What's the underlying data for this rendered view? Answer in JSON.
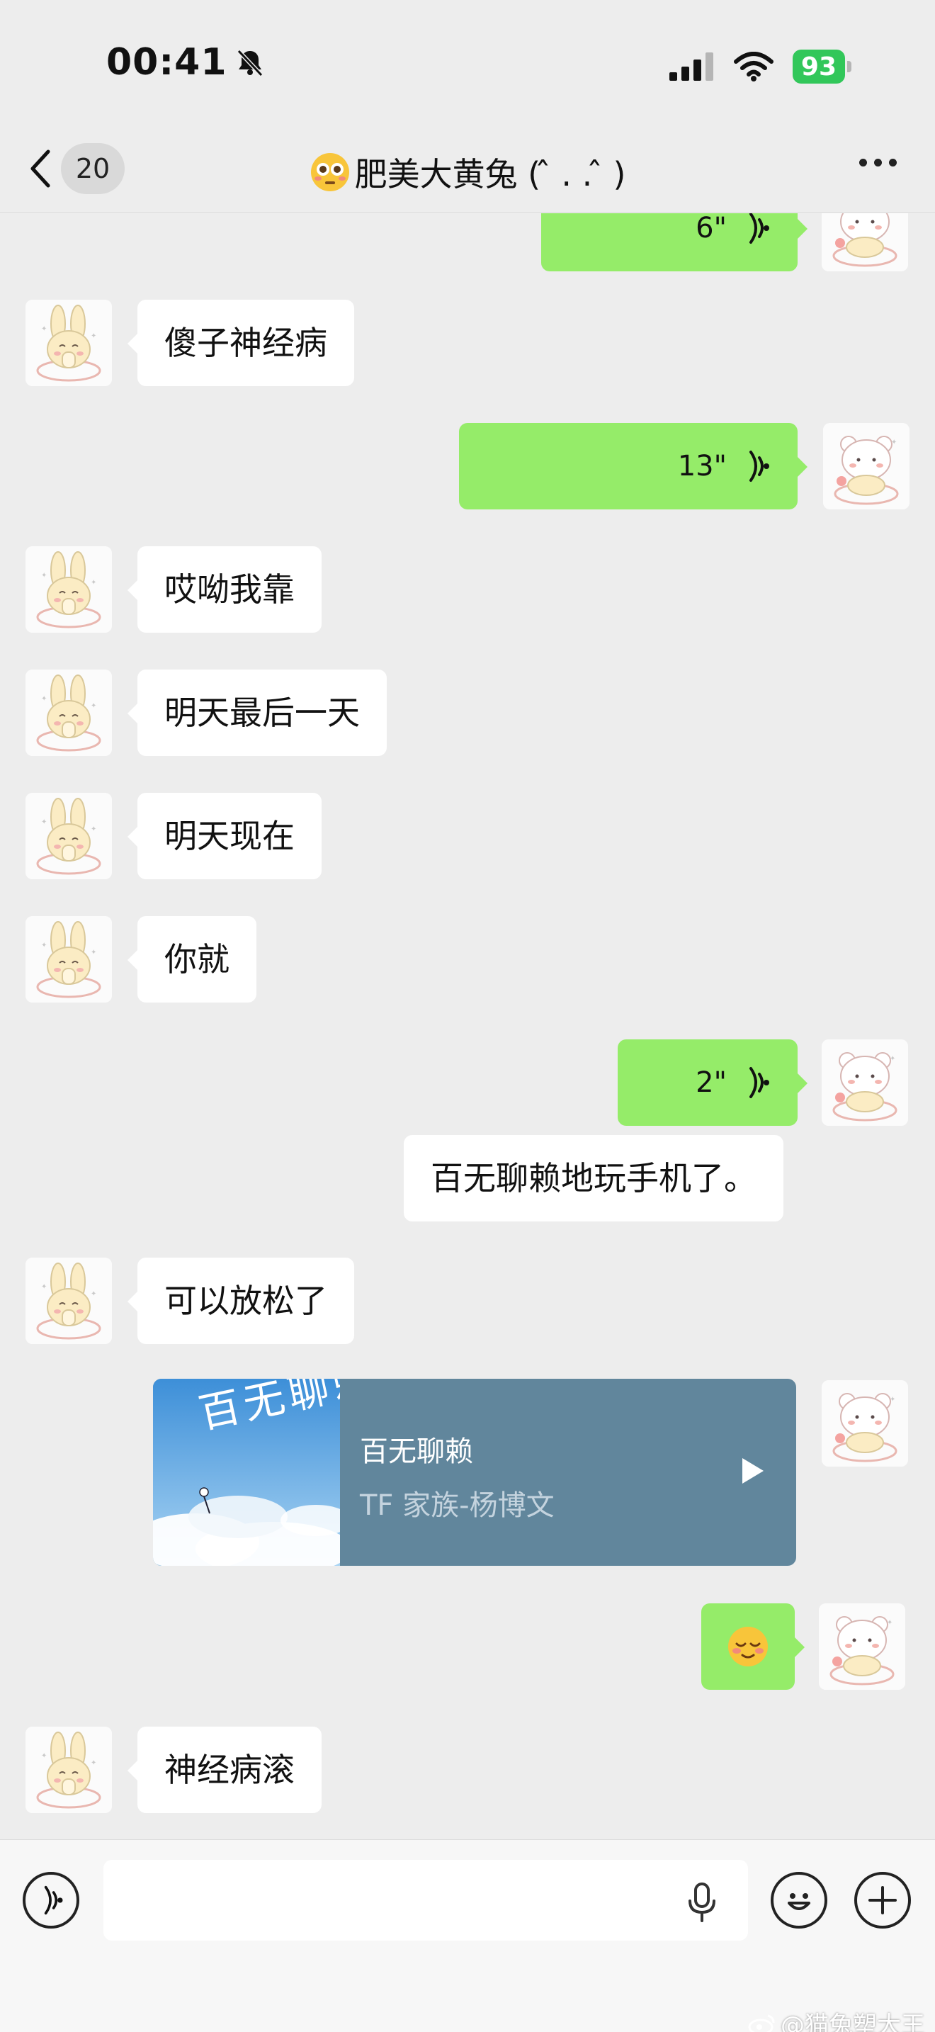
{
  "status_bar": {
    "time": "00:41",
    "battery": "93",
    "icons": [
      "bell-slash-icon",
      "cellular-signal-icon",
      "wifi-icon",
      "battery-icon"
    ]
  },
  "nav": {
    "back_count": "20",
    "title": "肥美大黄兔 ( ̂ . . ̂ )",
    "title_emoji": "flushed-face-emoji",
    "more_icon": "more-dots-icon"
  },
  "messages": [
    {
      "side": "right",
      "type": "voice",
      "duration": "6\""
    },
    {
      "side": "left",
      "type": "text",
      "text": "傻子神经病"
    },
    {
      "side": "right",
      "type": "voice",
      "duration": "13\""
    },
    {
      "side": "left",
      "type": "text",
      "text": "哎呦我靠"
    },
    {
      "side": "left",
      "type": "text",
      "text": "明天最后一天"
    },
    {
      "side": "left",
      "type": "text",
      "text": "明天现在"
    },
    {
      "side": "left",
      "type": "text",
      "text": "你就"
    },
    {
      "side": "right",
      "type": "voice",
      "duration": "2\""
    },
    {
      "side": "right",
      "type": "text",
      "text": "百无聊赖地玩手机了。"
    },
    {
      "side": "left",
      "type": "text",
      "text": "可以放松了"
    },
    {
      "side": "right",
      "type": "music",
      "song": "百无聊赖",
      "artist": "TF 家族-杨博文",
      "cover_text": "百无聊赖"
    },
    {
      "side": "right",
      "type": "emoji",
      "emoji": "relieved-face-emoji"
    },
    {
      "side": "left",
      "type": "text",
      "text": "神经病滚"
    }
  ],
  "input_bar": {
    "voice_toggle_icon": "voice-toggle-icon",
    "mic_icon": "microphone-icon",
    "emoji_icon": "smile-icon",
    "plus_icon": "plus-icon"
  },
  "watermark": "@猫兔塑大王",
  "colors": {
    "background": "#ededed",
    "sent_bubble": "#95ec69",
    "received_bubble": "#ffffff",
    "music_card": "#61869c",
    "battery": "#32c75a"
  }
}
